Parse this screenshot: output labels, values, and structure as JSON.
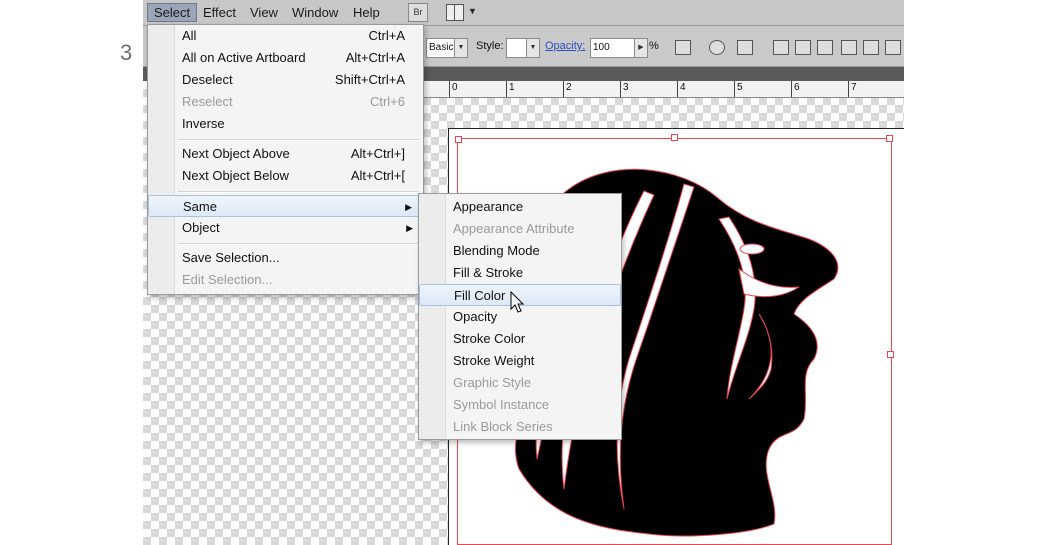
{
  "step_number": "3",
  "menubar": {
    "items": [
      "Select",
      "Effect",
      "View",
      "Window",
      "Help"
    ],
    "br_label": "Br"
  },
  "control_bar": {
    "profile_value": "Basic",
    "style_label": "Style:",
    "opacity_label": "Opacity:",
    "opacity_value": "100",
    "opacity_unit": "%"
  },
  "ruler": {
    "labels": [
      "0",
      "1",
      "2",
      "3",
      "4",
      "5",
      "6",
      "7"
    ]
  },
  "select_menu": {
    "items": [
      {
        "label": "All",
        "shortcut": "Ctrl+A",
        "enabled": true
      },
      {
        "label": "All on Active Artboard",
        "shortcut": "Alt+Ctrl+A",
        "enabled": true
      },
      {
        "label": "Deselect",
        "shortcut": "Shift+Ctrl+A",
        "enabled": true
      },
      {
        "label": "Reselect",
        "shortcut": "Ctrl+6",
        "enabled": false
      },
      {
        "label": "Inverse",
        "shortcut": "",
        "enabled": true
      },
      {
        "label": "Next Object Above",
        "shortcut": "Alt+Ctrl+]",
        "enabled": true
      },
      {
        "label": "Next Object Below",
        "shortcut": "Alt+Ctrl+[",
        "enabled": true
      },
      {
        "label": "Same",
        "shortcut": "",
        "enabled": true,
        "submenu": true,
        "highlighted": true
      },
      {
        "label": "Object",
        "shortcut": "",
        "enabled": true,
        "submenu": true
      },
      {
        "label": "Save Selection...",
        "shortcut": "",
        "enabled": true
      },
      {
        "label": "Edit Selection...",
        "shortcut": "",
        "enabled": false
      }
    ]
  },
  "same_submenu": {
    "items": [
      {
        "label": "Appearance",
        "enabled": true
      },
      {
        "label": "Appearance Attribute",
        "enabled": false
      },
      {
        "label": "Blending Mode",
        "enabled": true
      },
      {
        "label": "Fill & Stroke",
        "enabled": true
      },
      {
        "label": "Fill Color",
        "enabled": true,
        "highlighted": true
      },
      {
        "label": "Opacity",
        "enabled": true
      },
      {
        "label": "Stroke Color",
        "enabled": true
      },
      {
        "label": "Stroke Weight",
        "enabled": true
      },
      {
        "label": "Graphic Style",
        "enabled": false
      },
      {
        "label": "Symbol Instance",
        "enabled": false
      },
      {
        "label": "Link Block Series",
        "enabled": false
      }
    ]
  },
  "colors": {
    "selection": "#e8474f",
    "menu_highlight": "#dde9f7"
  },
  "icons": [
    "cursor-arrow-icon",
    "submenu-arrow-icon",
    "layout-icon",
    "align-icon"
  ]
}
